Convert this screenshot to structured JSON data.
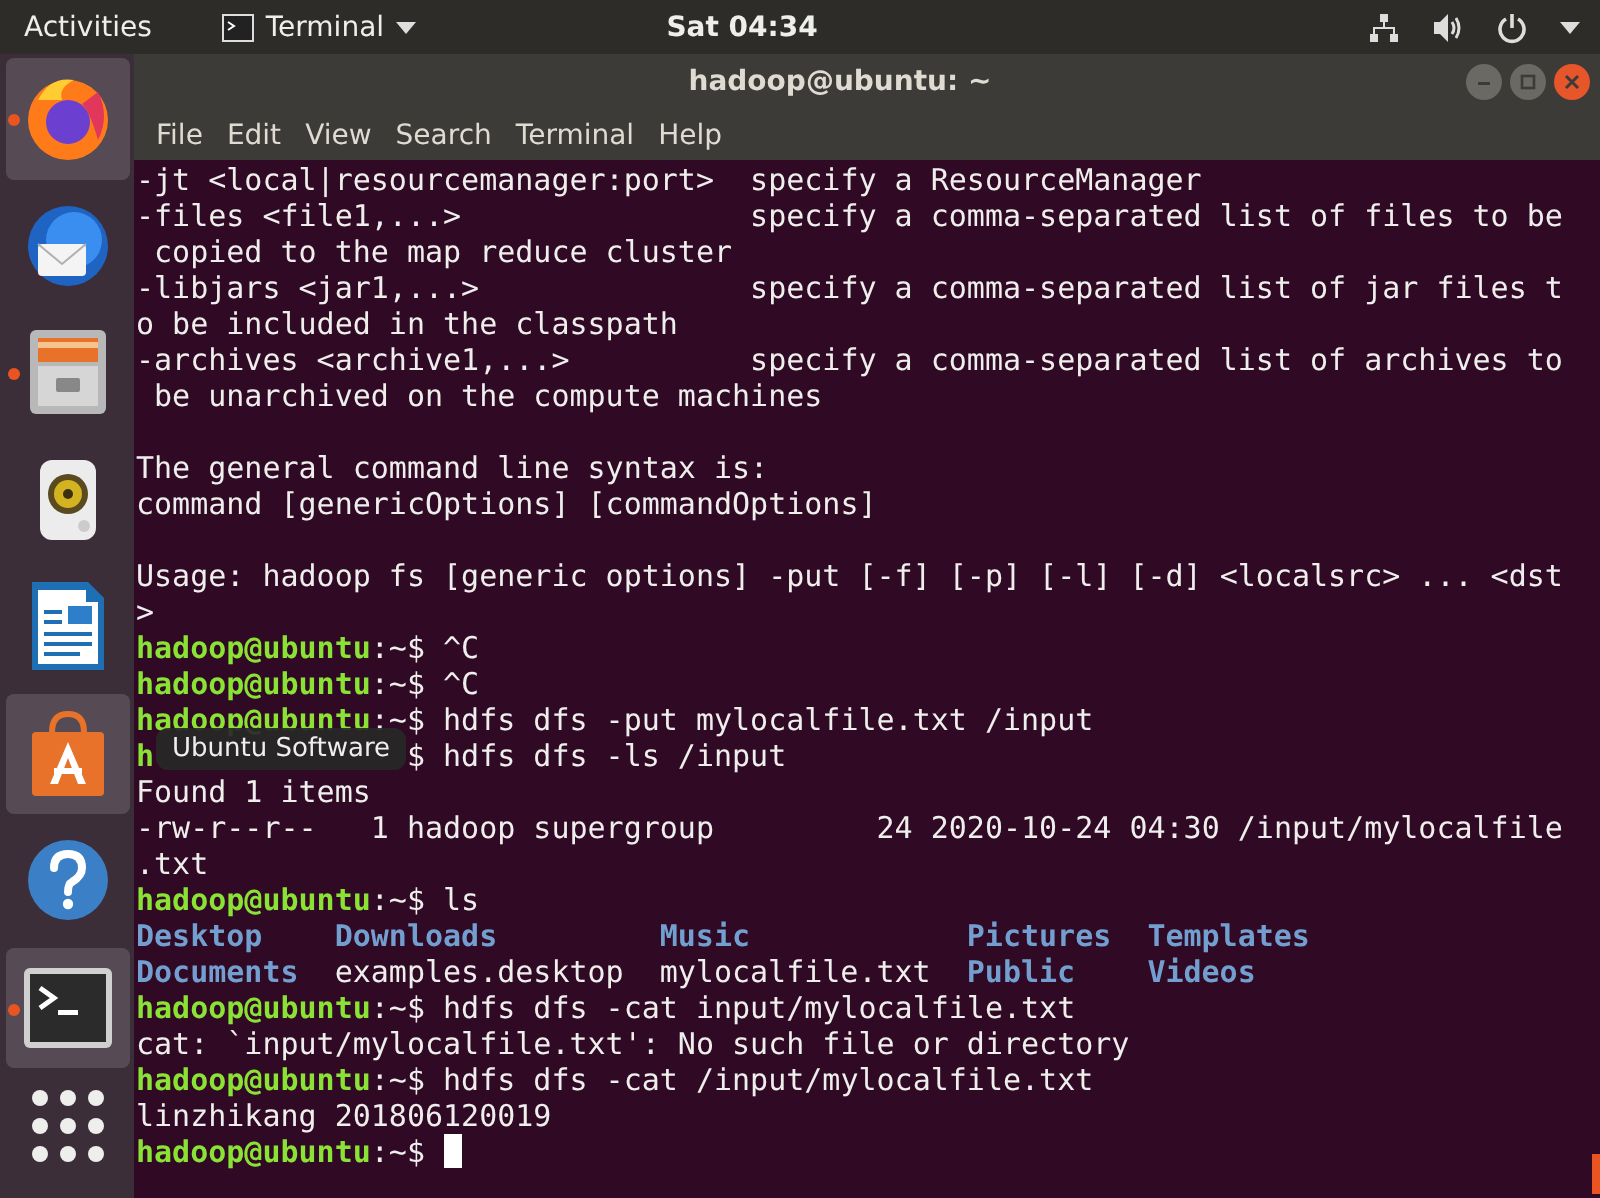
{
  "top_bar": {
    "activities": "Activities",
    "app_menu": "Terminal",
    "clock": "Sat 04:34"
  },
  "dock": {
    "items": [
      {
        "running": true,
        "highlighted": true
      },
      {
        "running": false,
        "highlighted": false
      },
      {
        "running": true,
        "highlighted": false
      },
      {
        "running": false,
        "highlighted": false
      },
      {
        "running": false,
        "highlighted": false
      },
      {
        "running": false,
        "highlighted": true
      },
      {
        "running": false,
        "highlighted": false
      },
      {
        "running": true,
        "highlighted": true
      }
    ],
    "tooltip": "Ubuntu Software"
  },
  "window": {
    "title": "hadoop@ubuntu: ~",
    "menu": [
      "File",
      "Edit",
      "View",
      "Search",
      "Terminal",
      "Help"
    ]
  },
  "terminal": {
    "lines": [
      {
        "kind": "output",
        "text": "-jt <local|resourcemanager:port>  specify a ResourceManager"
      },
      {
        "kind": "output",
        "text": "-files <file1,...>                specify a comma-separated list of files to be"
      },
      {
        "kind": "output",
        "text": " copied to the map reduce cluster"
      },
      {
        "kind": "output",
        "text": "-libjars <jar1,...>               specify a comma-separated list of jar files t"
      },
      {
        "kind": "output",
        "text": "o be included in the classpath"
      },
      {
        "kind": "output",
        "text": "-archives <archive1,...>          specify a comma-separated list of archives to"
      },
      {
        "kind": "output",
        "text": " be unarchived on the compute machines"
      },
      {
        "kind": "blank"
      },
      {
        "kind": "output",
        "text": "The general command line syntax is:"
      },
      {
        "kind": "output",
        "text": "command [genericOptions] [commandOptions]"
      },
      {
        "kind": "blank"
      },
      {
        "kind": "output",
        "text": "Usage: hadoop fs [generic options] -put [-f] [-p] [-l] [-d] <localsrc> ... <dst"
      },
      {
        "kind": "output",
        "text": ">"
      },
      {
        "kind": "prompt",
        "user": "hadoop@ubuntu",
        "path": ":~$",
        "command": "^C",
        "cursor": false
      },
      {
        "kind": "prompt",
        "user": "hadoop@ubuntu",
        "path": ":~$",
        "command": "^C",
        "cursor": false
      },
      {
        "kind": "prompt",
        "user": "hadoop@ubuntu",
        "path": ":~$",
        "command": "hdfs dfs -put mylocalfile.txt /input",
        "cursor": false
      },
      {
        "kind": "covered",
        "head": "h",
        "tail": "$ hdfs dfs -ls /input"
      },
      {
        "kind": "output",
        "text": "Found 1 items"
      },
      {
        "kind": "output",
        "text": "-rw-r--r--   1 hadoop supergroup         24 2020-10-24 04:30 /input/mylocalfile"
      },
      {
        "kind": "output",
        "text": ".txt"
      },
      {
        "kind": "prompt",
        "user": "hadoop@ubuntu",
        "path": ":~$",
        "command": "ls",
        "cursor": false
      },
      {
        "kind": "ls",
        "cells": [
          {
            "text": "Desktop",
            "dir": true
          },
          {
            "text": "Downloads",
            "dir": true
          },
          {
            "text": "Music",
            "dir": true
          },
          {
            "text": "Pictures",
            "dir": true
          },
          {
            "text": "Templates",
            "dir": true
          }
        ]
      },
      {
        "kind": "ls",
        "cells": [
          {
            "text": "Documents",
            "dir": true
          },
          {
            "text": "examples.desktop",
            "dir": false
          },
          {
            "text": "mylocalfile.txt",
            "dir": false
          },
          {
            "text": "Public",
            "dir": true
          },
          {
            "text": "Videos",
            "dir": true
          }
        ]
      },
      {
        "kind": "prompt",
        "user": "hadoop@ubuntu",
        "path": ":~$",
        "command": "hdfs dfs -cat input/mylocalfile.txt",
        "cursor": false
      },
      {
        "kind": "output",
        "text": "cat: `input/mylocalfile.txt': No such file or directory"
      },
      {
        "kind": "prompt",
        "user": "hadoop@ubuntu",
        "path": ":~$",
        "command": "hdfs dfs -cat /input/mylocalfile.txt",
        "cursor": false
      },
      {
        "kind": "output",
        "text": "linzhikang 201806120019"
      },
      {
        "kind": "prompt",
        "user": "hadoop@ubuntu",
        "path": ":~$",
        "cursor": true
      }
    ]
  }
}
